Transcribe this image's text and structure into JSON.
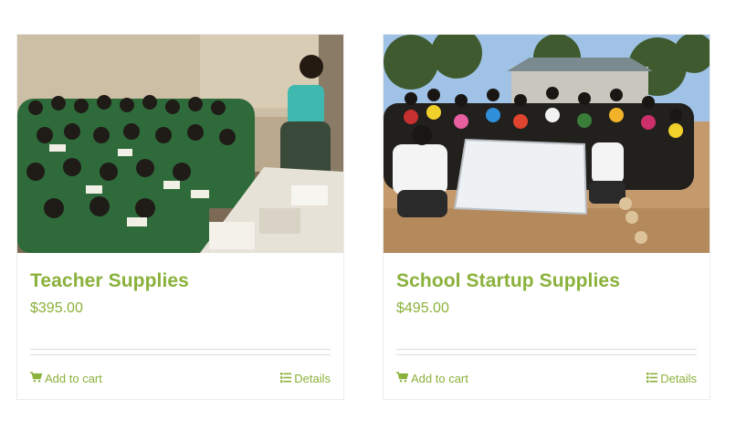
{
  "products": [
    {
      "title": "Teacher Supplies",
      "price": "$395.00",
      "add_to_cart": "Add to cart",
      "details": "Details"
    },
    {
      "title": "School Startup Supplies",
      "price": "$495.00",
      "add_to_cart": "Add to cart",
      "details": "Details"
    }
  ],
  "icons": {
    "add_to_cart": "cart-icon",
    "details": "list-icon"
  },
  "colors": {
    "accent": "#8ab13a",
    "separator": "#dcdcdc",
    "border": "#ececec"
  }
}
